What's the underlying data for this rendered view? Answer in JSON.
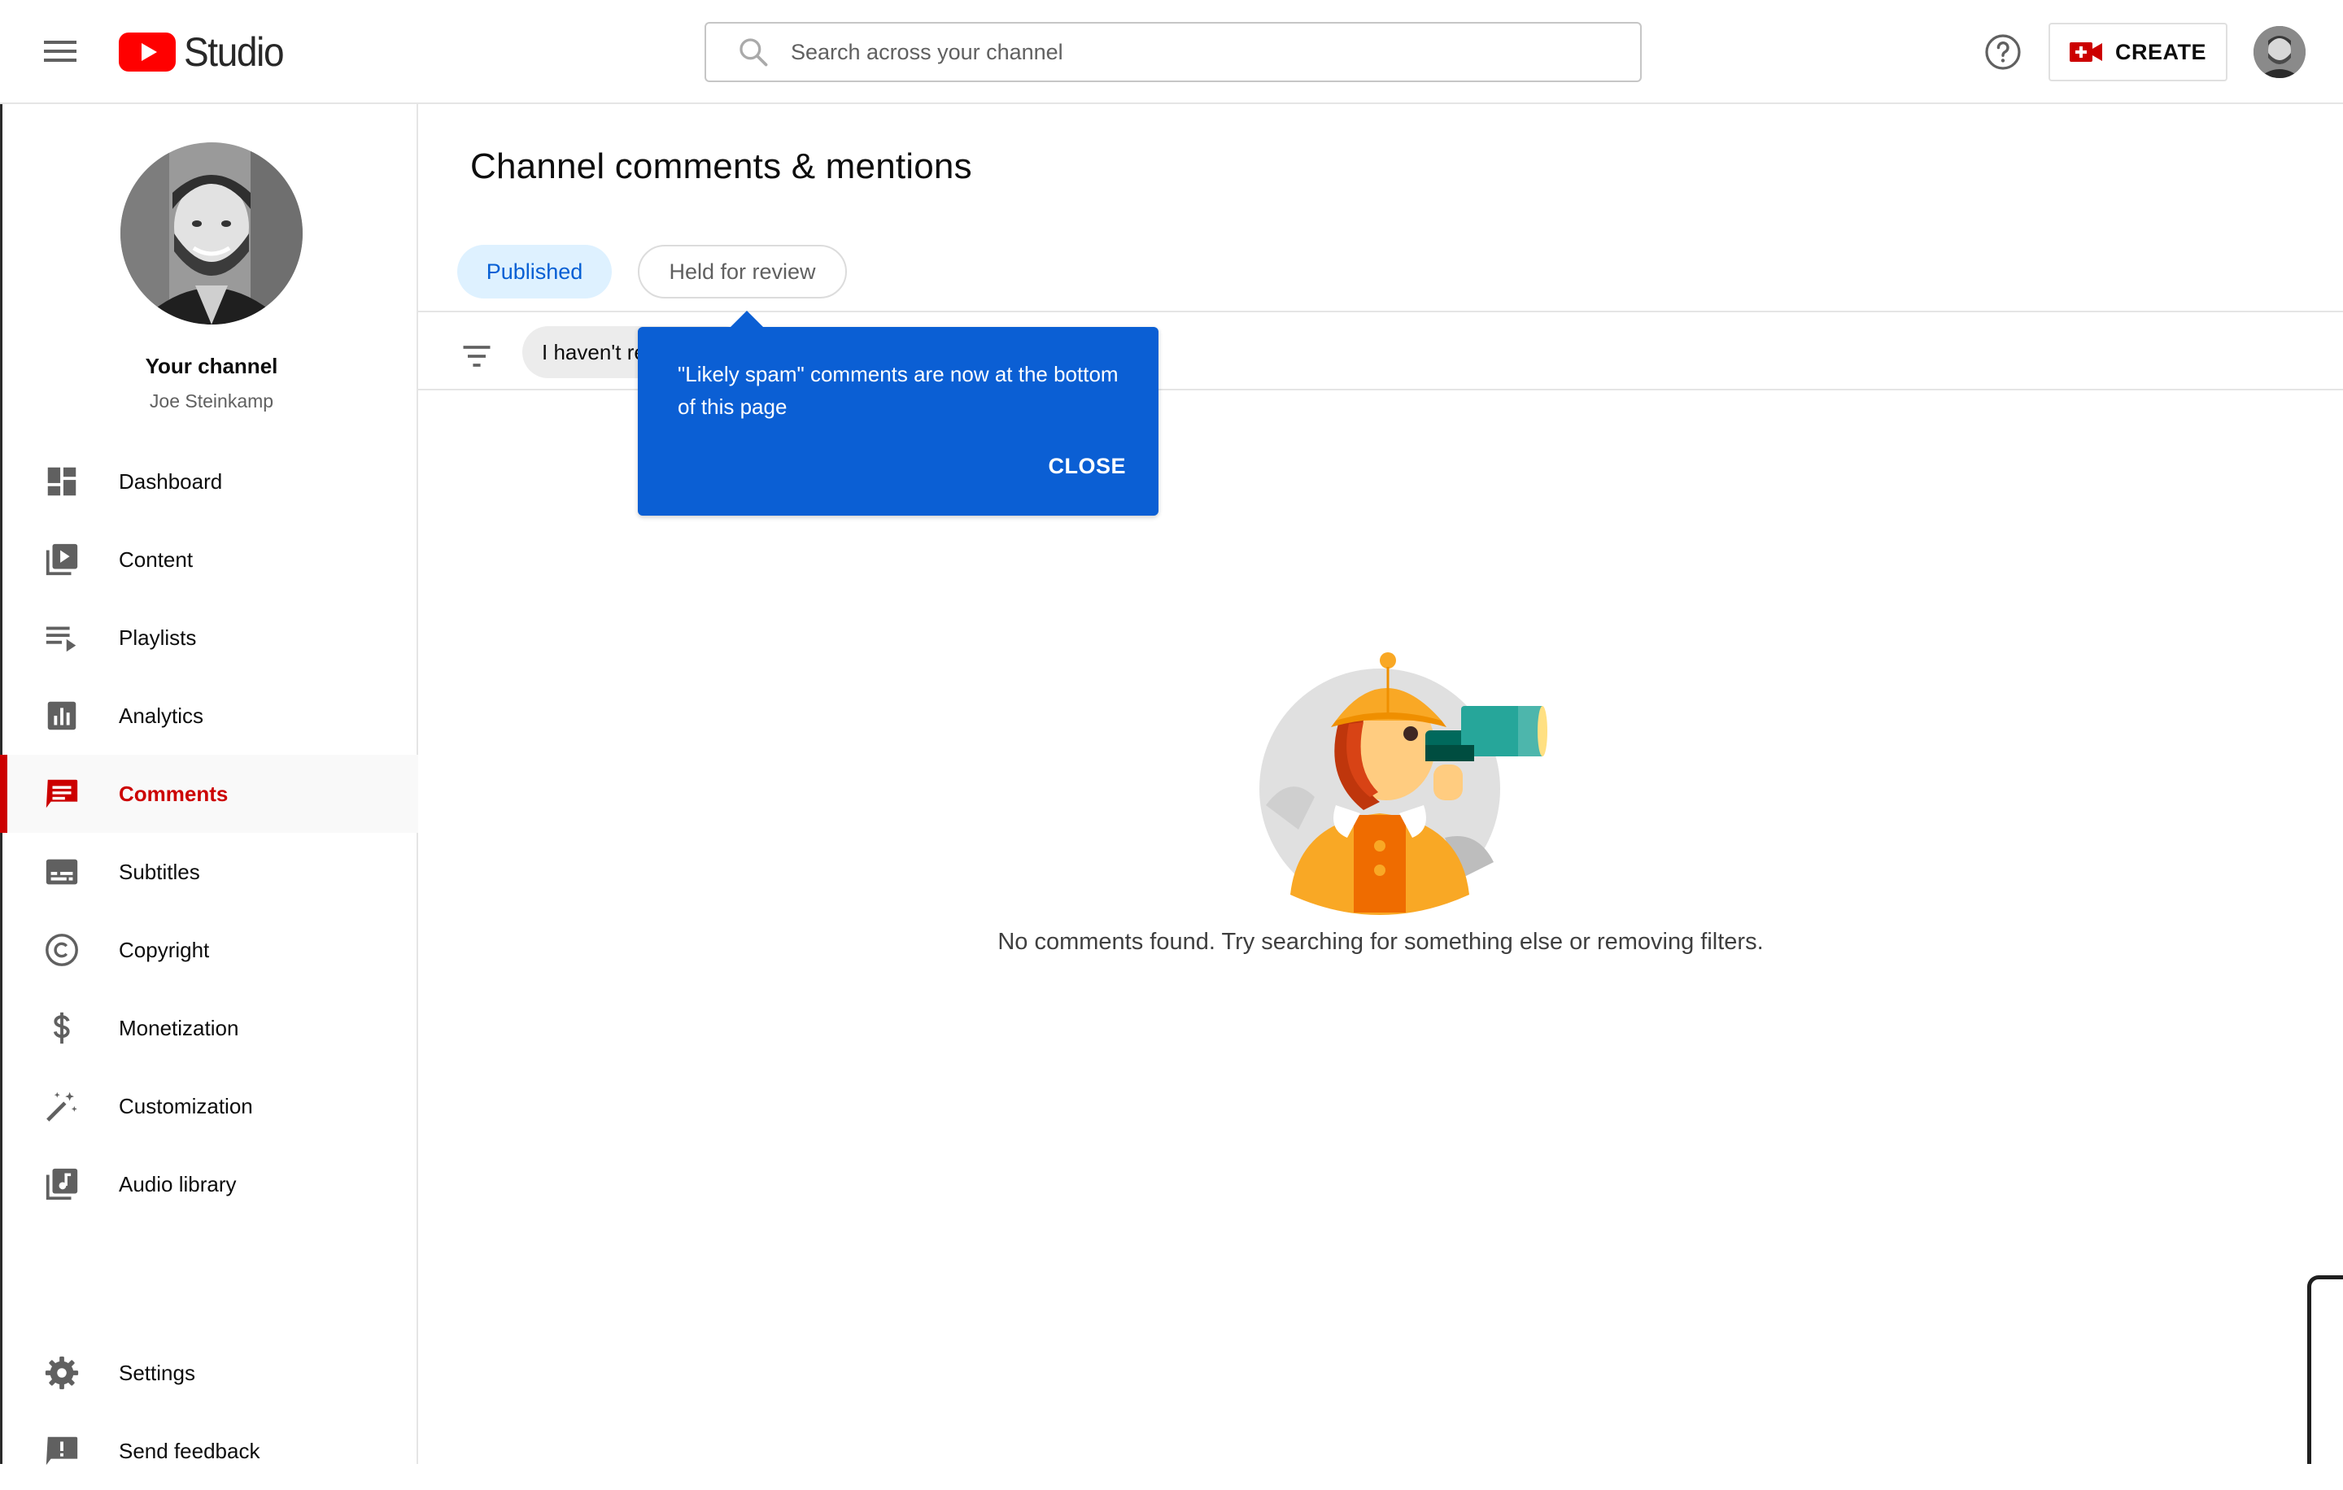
{
  "header": {
    "logo_text": "Studio",
    "search_placeholder": "Search across your channel",
    "create_label": "CREATE"
  },
  "sidebar": {
    "channel_title": "Your channel",
    "channel_name": "Joe Steinkamp",
    "items": [
      {
        "label": "Dashboard",
        "icon": "dashboard-icon"
      },
      {
        "label": "Content",
        "icon": "content-icon"
      },
      {
        "label": "Playlists",
        "icon": "playlists-icon"
      },
      {
        "label": "Analytics",
        "icon": "analytics-icon"
      },
      {
        "label": "Comments",
        "icon": "comments-icon",
        "active": true
      },
      {
        "label": "Subtitles",
        "icon": "subtitles-icon"
      },
      {
        "label": "Copyright",
        "icon": "copyright-icon"
      },
      {
        "label": "Monetization",
        "icon": "dollar-icon"
      },
      {
        "label": "Customization",
        "icon": "magic-wand-icon"
      },
      {
        "label": "Audio library",
        "icon": "audio-library-icon"
      }
    ],
    "bottom_items": [
      {
        "label": "Settings",
        "icon": "gear-icon"
      },
      {
        "label": "Send feedback",
        "icon": "feedback-icon"
      }
    ]
  },
  "main": {
    "title": "Channel comments & mentions",
    "tabs": [
      {
        "label": "Published",
        "selected": true
      },
      {
        "label": "Held for review",
        "selected": false
      }
    ],
    "filter_chip": "I haven't responded to",
    "tooltip": {
      "text": "\"Likely spam\" comments are now at the bottom of this page",
      "close_label": "CLOSE"
    },
    "empty_message": "No comments found. Try searching for something else or removing filters."
  },
  "colors": {
    "accent_red": "#cc0000",
    "tooltip_blue": "#0b5fd4",
    "tab_selected_bg": "#def1ff",
    "tab_selected_text": "#065fd4"
  }
}
